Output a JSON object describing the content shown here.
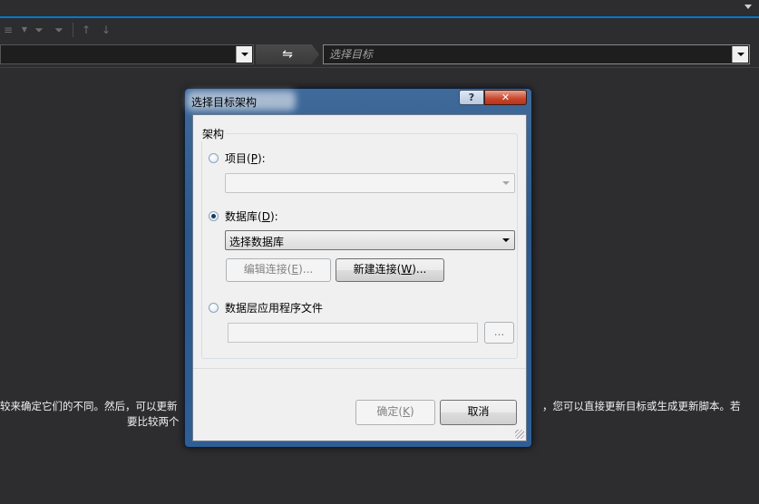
{
  "toolbar": {
    "icons": [
      "list-filter-icon",
      "dropdown-caret-icon",
      "filter-icon",
      "filter-clear-icon",
      "arrow-up-icon",
      "arrow-down-icon"
    ]
  },
  "compare_bar": {
    "source_value": "",
    "swap_glyph": "⇋",
    "target_placeholder": "选择目标"
  },
  "description": {
    "left_line1": "较来确定它们的不同。然后，可以更新",
    "left_line2": "要比较两个",
    "right_line1": "，您可以直接更新目标或生成更新脚本。若"
  },
  "dialog": {
    "title": "选择目标架构",
    "help_glyph": "?",
    "close_glyph": "✕",
    "group_label": "架构",
    "project": {
      "label_pre": "项目(",
      "accel": "P",
      "label_post": "):",
      "selected": false,
      "combo_value": ""
    },
    "database": {
      "label_pre": "数据库(",
      "accel": "D",
      "label_post": "):",
      "selected": true,
      "combo_value": "选择数据库"
    },
    "edit_connection": {
      "pre": "编辑连接(",
      "accel": "E",
      "post": ")..."
    },
    "new_connection": {
      "pre": "新建连接(",
      "accel": "W",
      "post": ")..."
    },
    "dacpac": {
      "label": "数据层应用程序文件",
      "selected": false,
      "path": "",
      "browse": "..."
    },
    "ok": {
      "pre": "确定(",
      "accel": "K",
      "post": ")"
    },
    "cancel": "取消"
  },
  "colors": {
    "accent": "#007acc",
    "background": "#2d2d30"
  }
}
